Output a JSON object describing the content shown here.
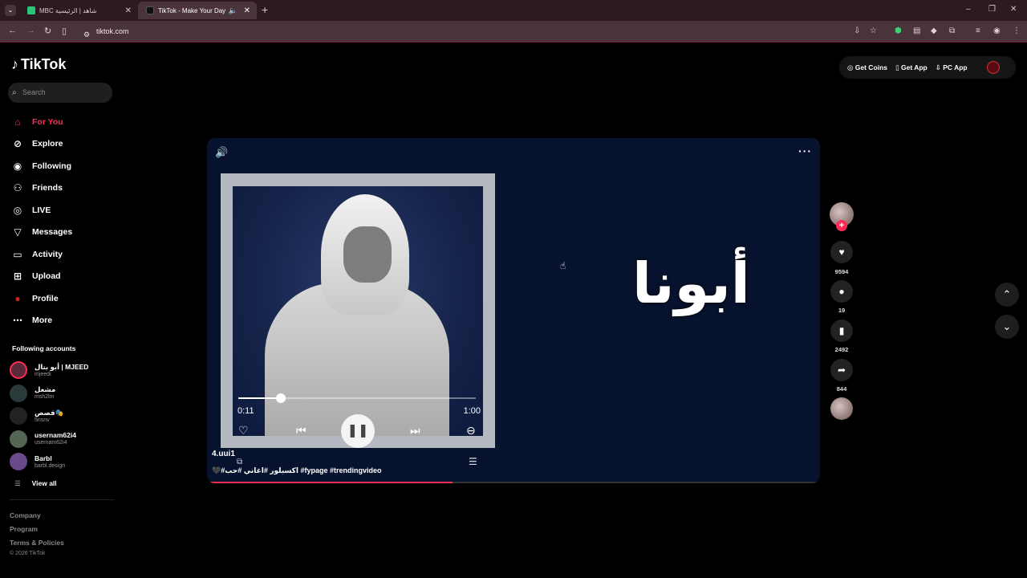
{
  "browser": {
    "tabs": [
      {
        "title": "MBC شاهد | الرئيسية",
        "favicon_color": "#2ac67a"
      },
      {
        "title": "TikTok - Make Your Day",
        "favicon_color": "#111111"
      }
    ],
    "url": "tiktok.com",
    "new_tab": "+",
    "minimize": "–",
    "restore": "❐",
    "close": "✕"
  },
  "sidebar": {
    "logo": "TikTok",
    "search_placeholder": "Search",
    "menu": [
      {
        "label": "For You",
        "icon": "home-icon",
        "glyph": "⌂",
        "active": true
      },
      {
        "label": "Explore",
        "icon": "compass-icon",
        "glyph": "⊘"
      },
      {
        "label": "Following",
        "icon": "following-icon",
        "glyph": "◉"
      },
      {
        "label": "Friends",
        "icon": "friends-icon",
        "glyph": "⚇"
      },
      {
        "label": "LIVE",
        "icon": "live-icon",
        "glyph": "◎"
      },
      {
        "label": "Messages",
        "icon": "messages-icon",
        "glyph": "▽"
      },
      {
        "label": "Activity",
        "icon": "activity-icon",
        "glyph": "▭"
      },
      {
        "label": "Upload",
        "icon": "upload-icon",
        "glyph": "⊞"
      },
      {
        "label": "Profile",
        "icon": "profile-icon",
        "glyph": "●"
      },
      {
        "label": "More",
        "icon": "more-icon",
        "glyph": "⋯"
      }
    ],
    "following_title": "Following accounts",
    "accounts": [
      {
        "name": "أبو بتال | MJEED",
        "handle": "mjeedi",
        "color": "#5a2a3a"
      },
      {
        "name": "مشعل",
        "handle": "msh2lm",
        "color": "#2a3a3a"
      },
      {
        "name": "قصص🎭",
        "handle": "5nsnv",
        "color": "#222222"
      },
      {
        "name": "usernam62i4",
        "handle": "usernam62i4",
        "color": "#556655"
      },
      {
        "name": "Barbl",
        "handle": "barbl.design",
        "color": "#6a4a8a"
      }
    ],
    "view_all": "View all",
    "footer": [
      "Company",
      "Program",
      "Terms & Policies"
    ],
    "copyright": "© 2026 TikTok"
  },
  "topright": {
    "get_coins": "Get Coins",
    "get_app": "Get App",
    "pc_app": "PC App"
  },
  "video": {
    "time_current": "0:11",
    "time_duration": "1:00",
    "scrub_fraction": 0.18,
    "progress_fraction": 0.4,
    "overlay_text": "أبونا",
    "author": "4.uui1",
    "caption": "🖤#اكسبلور #اغاني #حب #fypage #trendingvideo"
  },
  "rail": {
    "likes": "9594",
    "comments": "19",
    "saves": "2492",
    "shares": "844"
  },
  "colors": {
    "accent": "#fe2c55",
    "video_bg": "#07132e"
  }
}
